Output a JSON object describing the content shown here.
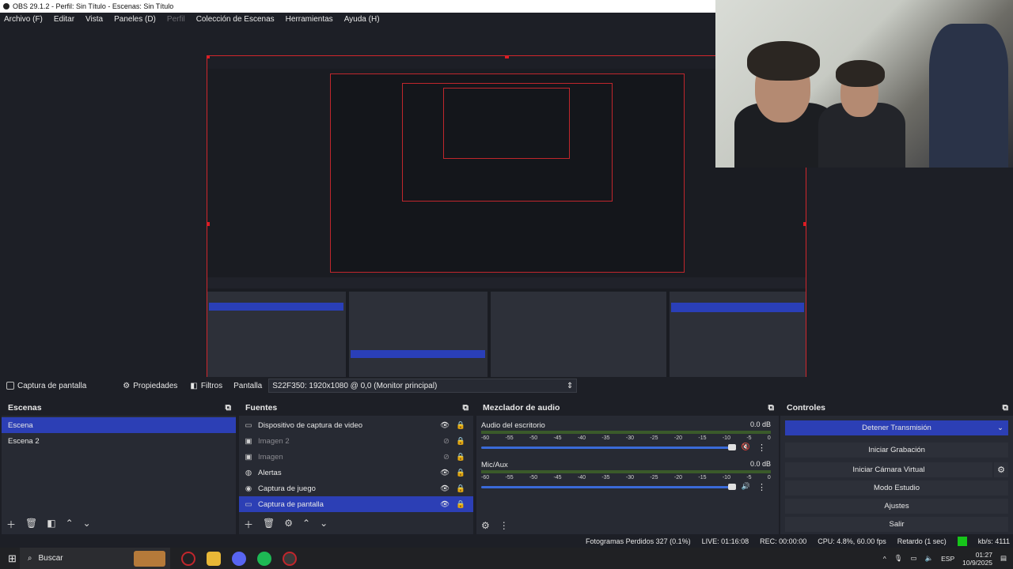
{
  "window": {
    "title": "OBS 29.1.2 - Perfil: Sin Título - Escenas: Sin Título"
  },
  "menu": [
    {
      "label": "Archivo (F)",
      "dim": false
    },
    {
      "label": "Editar",
      "dim": false
    },
    {
      "label": "Vista",
      "dim": false
    },
    {
      "label": "Paneles (D)",
      "dim": false
    },
    {
      "label": "Perfil",
      "dim": true
    },
    {
      "label": "Colección de Escenas",
      "dim": false
    },
    {
      "label": "Herramientas",
      "dim": false
    },
    {
      "label": "Ayuda (H)",
      "dim": false
    }
  ],
  "source_toolbar": {
    "selected_source": "Captura de pantalla",
    "properties": "Propiedades",
    "filters": "Filtros",
    "display_label": "Pantalla",
    "display_value": "S22F350: 1920x1080 @ 0,0 (Monitor principal)"
  },
  "scenes": {
    "title": "Escenas",
    "items": [
      "Escena",
      "Escena 2"
    ],
    "selected": 0
  },
  "sources": {
    "title": "Fuentes",
    "items": [
      {
        "label": "Dispositivo de captura de video",
        "icon": "camera-icon",
        "visible": true,
        "muted": false
      },
      {
        "label": "Imagen 2",
        "icon": "image-icon",
        "visible": false,
        "muted": true
      },
      {
        "label": "Imagen",
        "icon": "image-icon",
        "visible": false,
        "muted": true
      },
      {
        "label": "Alertas",
        "icon": "browser-icon",
        "visible": true,
        "muted": false
      },
      {
        "label": "Captura de juego",
        "icon": "gamepad-icon",
        "visible": true,
        "muted": false
      },
      {
        "label": "Captura de pantalla",
        "icon": "monitor-icon",
        "visible": true,
        "muted": false
      }
    ],
    "selected": 5
  },
  "mixer": {
    "title": "Mezclador de audio",
    "channels": [
      {
        "name": "Audio del escritorio",
        "db": "0.0 dB",
        "level": 0.0
      },
      {
        "name": "Mic/Aux",
        "db": "0.0 dB",
        "level": 0.0
      }
    ],
    "scale": [
      "-60",
      "-55",
      "-50",
      "-45",
      "-40",
      "-35",
      "-30",
      "-25",
      "-20",
      "-15",
      "-10",
      "-5",
      "0"
    ]
  },
  "controls": {
    "title": "Controles",
    "stop_stream": "Detener Transmisión",
    "start_recording": "Iniciar Grabación",
    "start_virtual_cam": "Iniciar Cámara Virtual",
    "studio_mode": "Modo Estudio",
    "settings": "Ajustes",
    "exit": "Salir"
  },
  "status": {
    "dropped_frames": "Fotogramas Perdidos 327 (0.1%)",
    "live": "LIVE: 01:16:08",
    "rec": "REC: 00:00:00",
    "cpu": "CPU: 4.8%, 60.00 fps",
    "delay": "Retardo (1 sec)",
    "kbps": "kb/s: 4111"
  },
  "taskbar": {
    "search": "Buscar",
    "lang": "ESP",
    "time": "01:27",
    "date": "10/9/2025"
  },
  "colors": {
    "accent": "#2c3fb5",
    "live": "#16c41a",
    "preview_border": "#d0262c"
  }
}
